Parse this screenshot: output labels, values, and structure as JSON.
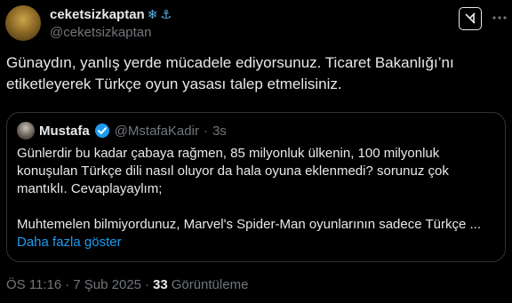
{
  "author": {
    "display_name": "ceketsizkaptan",
    "emojis": [
      "snowflake-icon",
      "anchor-icon"
    ],
    "handle": "@ceketsizkaptan"
  },
  "tweet": {
    "text_line1": "Günaydın, yanlış yerde mücadele ediyorsunuz. Ticaret Bakanlığı’nı",
    "text_line2": "etiketleyerek Türkçe oyun yasası talep etmelisiniz."
  },
  "quote": {
    "name": "Mustafa",
    "handle": "@MstafaKadir",
    "separator": "·",
    "time": "3s",
    "line1": "Günlerdir bu kadar çabaya rağmen, 85 milyonluk ülkenin, 100 milyonluk",
    "line2": "konuşulan Türkçe dili nasıl oluyor da hala oyuna eklenmedi? sorunuz çok",
    "line3": "mantıklı. Cevaplayaylım;",
    "line4": "Muhtemelen bilmiyordunuz, Marvel's Spider-Man oyunlarının sadece Türkçe ...",
    "show_more": "Daha fazla göster"
  },
  "footer": {
    "time": "ÖS 11:16",
    "dot1": "·",
    "date": "7 Şub 2025",
    "dot2": "·",
    "views_count": "33",
    "views_label": "Görüntüleme"
  },
  "colors": {
    "background": "#000000",
    "text": "#e7e9ea",
    "muted": "#71767b",
    "link": "#1d9bf0",
    "verified": "#1d9bf0",
    "border": "#2f3336"
  }
}
